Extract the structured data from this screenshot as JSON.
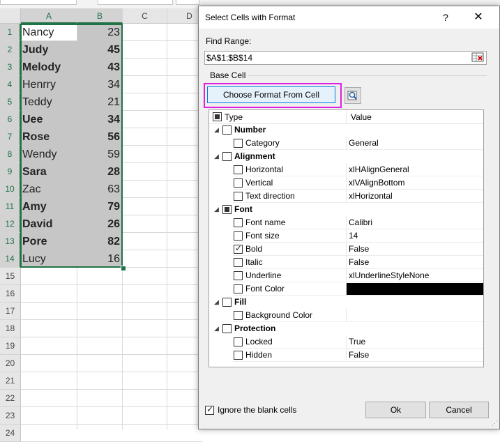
{
  "sheet": {
    "columns": [
      "A",
      "B",
      "C",
      "D"
    ],
    "row_numbers": [
      "1",
      "2",
      "3",
      "4",
      "5",
      "6",
      "7",
      "8",
      "9",
      "10",
      "11",
      "12",
      "13",
      "14",
      "15",
      "16",
      "17",
      "18",
      "19",
      "20",
      "21",
      "22",
      "23",
      "24"
    ],
    "rows": [
      {
        "name": "Nancy",
        "value": "23",
        "bold": false
      },
      {
        "name": "Judy",
        "value": "45",
        "bold": true
      },
      {
        "name": "Melody",
        "value": "43",
        "bold": true
      },
      {
        "name": "Henrry",
        "value": "34",
        "bold": false
      },
      {
        "name": "Teddy",
        "value": "21",
        "bold": false
      },
      {
        "name": "Uee",
        "value": "34",
        "bold": true
      },
      {
        "name": "Rose",
        "value": "56",
        "bold": true
      },
      {
        "name": "Wendy",
        "value": "59",
        "bold": false
      },
      {
        "name": "Sara",
        "value": "28",
        "bold": true
      },
      {
        "name": "Zac",
        "value": "63",
        "bold": false
      },
      {
        "name": "Amy",
        "value": "79",
        "bold": true
      },
      {
        "name": "David",
        "value": "26",
        "bold": true
      },
      {
        "name": "Pore",
        "value": "82",
        "bold": true
      },
      {
        "name": "Lucy",
        "value": "16",
        "bold": false
      }
    ],
    "colors": {
      "selection": "#217346",
      "shade": "#c6c6c6"
    }
  },
  "dialog": {
    "title": "Select Cells with Format",
    "help_label": "?",
    "close_label": "✕",
    "find_range_label": "Find Range:",
    "find_range_value": "$A$1:$B$14",
    "base_cell_label": "Base Cell",
    "choose_format_label": "Choose Format From Cell",
    "highlight_color": "#e020e0",
    "tree": {
      "header_type": "Type",
      "header_value": "Value",
      "rows": [
        {
          "level": 0,
          "label": "Number",
          "value": "",
          "checked": false
        },
        {
          "level": 1,
          "label": "Category",
          "value": "General",
          "checked": false
        },
        {
          "level": 0,
          "label": "Alignment",
          "value": "",
          "checked": false
        },
        {
          "level": 1,
          "label": "Horizontal",
          "value": "xlHAlignGeneral",
          "checked": false
        },
        {
          "level": 1,
          "label": "Vertical",
          "value": "xlVAlignBottom",
          "checked": false
        },
        {
          "level": 1,
          "label": "Text direction",
          "value": "xlHorizontal",
          "checked": false
        },
        {
          "level": 0,
          "label": "Font",
          "value": "",
          "checked": "partial"
        },
        {
          "level": 1,
          "label": "Font name",
          "value": "Calibri",
          "checked": false
        },
        {
          "level": 1,
          "label": "Font size",
          "value": "14",
          "checked": false
        },
        {
          "level": 1,
          "label": "Bold",
          "value": "False",
          "checked": true
        },
        {
          "level": 1,
          "label": "Italic",
          "value": "False",
          "checked": false
        },
        {
          "level": 1,
          "label": "Underline",
          "value": "xlUnderlineStyleNone",
          "checked": false
        },
        {
          "level": 1,
          "label": "Font Color",
          "value": "",
          "checked": false,
          "swatch": "#000000"
        },
        {
          "level": 0,
          "label": "Fill",
          "value": "",
          "checked": false
        },
        {
          "level": 1,
          "label": "Background Color",
          "value": "",
          "checked": false
        },
        {
          "level": 0,
          "label": "Protection",
          "value": "",
          "checked": false
        },
        {
          "level": 1,
          "label": "Locked",
          "value": "True",
          "checked": false
        },
        {
          "level": 1,
          "label": "Hidden",
          "value": "False",
          "checked": false
        }
      ]
    },
    "ignore_blank_label": "Ignore the blank cells",
    "ignore_blank_checked": true,
    "ok_label": "Ok",
    "cancel_label": "Cancel"
  }
}
